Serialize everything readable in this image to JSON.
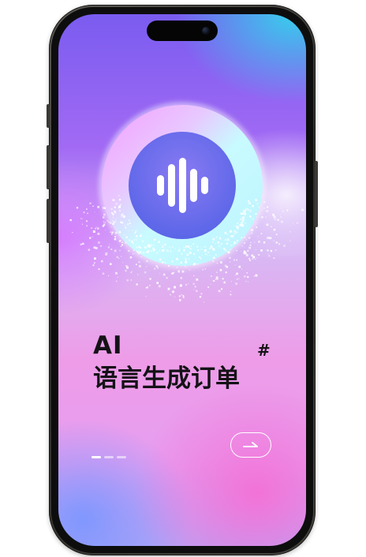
{
  "screen": {
    "headline": {
      "line1": "AI",
      "line2": "语言生成订单",
      "tag": "#"
    },
    "emblem": {
      "icon": "voice-waveform-icon"
    },
    "pager": {
      "total": 3,
      "active_index": 0
    },
    "next_button": {
      "icon": "arrow-right-icon"
    },
    "colors": {
      "text": "#141216",
      "accent_cyan": "#38ceec",
      "accent_purple": "#7a5cf0",
      "accent_pink": "#f470d6",
      "icon_white": "#ffffff"
    }
  }
}
